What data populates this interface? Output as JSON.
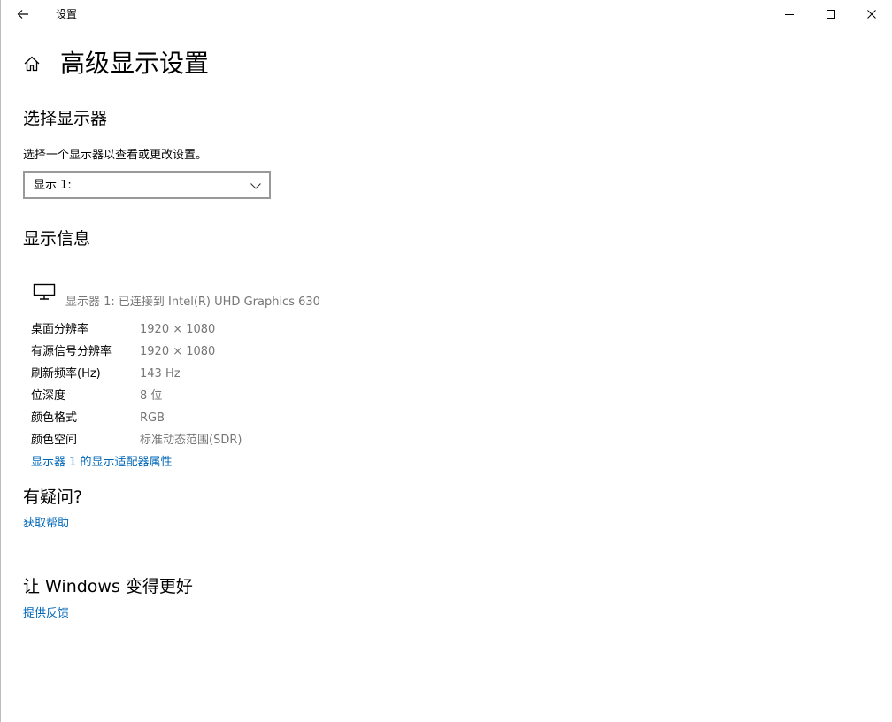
{
  "window": {
    "title": "设置"
  },
  "page": {
    "title": "高级显示设置"
  },
  "select_display": {
    "heading": "选择显示器",
    "description": "选择一个显示器以查看或更改设置。",
    "dropdown_value": "显示 1:"
  },
  "display_info": {
    "heading": "显示信息",
    "monitor_caption": "显示器 1: 已连接到 Intel(R) UHD Graphics 630",
    "rows": [
      {
        "label": "桌面分辨率",
        "value": "1920 × 1080"
      },
      {
        "label": "有源信号分辨率",
        "value": "1920 × 1080"
      },
      {
        "label": "刷新频率(Hz)",
        "value": "143 Hz"
      },
      {
        "label": "位深度",
        "value": "8 位"
      },
      {
        "label": "颜色格式",
        "value": "RGB"
      },
      {
        "label": "颜色空间",
        "value": "标准动态范围(SDR)"
      }
    ],
    "adapter_link": "显示器 1 的显示适配器属性"
  },
  "help": {
    "heading": "有疑问?",
    "link": "获取帮助"
  },
  "feedback": {
    "heading": "让 Windows 变得更好",
    "link": "提供反馈"
  },
  "icons": {
    "back": "back-arrow-icon",
    "minimize": "minimize-icon",
    "maximize": "maximize-icon",
    "close": "close-icon",
    "home": "home-icon",
    "monitor": "monitor-icon",
    "chevron": "chevron-down-icon"
  },
  "colors": {
    "link": "#0067b8",
    "secondary_text": "#767676",
    "border": "#999999"
  }
}
